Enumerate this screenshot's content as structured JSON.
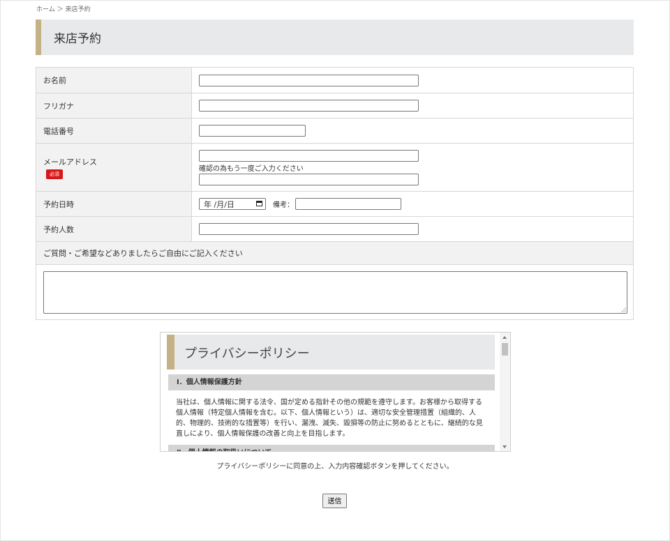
{
  "breadcrumb": "ホーム ＞ 来店予約",
  "title": "来店予約",
  "form": {
    "name_label": "お名前",
    "furigana_label": "フリガナ",
    "phone_label": "電話番号",
    "email_label": "メールアドレス",
    "required_badge": "必須",
    "email_confirm_note": "確認の為もう一度ご入力ください",
    "datetime_label": "予約日時",
    "date_placeholder": "年 /月/日",
    "remarks_label": "備考：",
    "party_size_label": "予約人数",
    "questions_label": "ご質問・ご希望などありましたらご自由にご記入ください"
  },
  "privacy": {
    "title": "プライバシーポリシー",
    "section1_title": "Ⅰ．個人情報保護方針",
    "section1_body": "当社は、個人情報に関する法令、国が定める指針その他の規範を遵守します。お客様から取得する個人情報（特定個人情報を含む。以下、個人情報という）は、適切な安全管理措置（組織的、人的、物理的、技術的な措置等）を行い、漏洩、滅失、毀損等の防止に努めるとともに、継続的な見直しにより、個人情報保護の改善と向上を目指します。",
    "section2_title": "Ⅱ．個人情報の取扱いについて"
  },
  "consent_text": "プライバシーポリシーに同意の上、入力内容確認ボタンを押してください。",
  "submit_label": "送信",
  "colors": {
    "accent": "#c4b185",
    "required": "#d81818",
    "label_bg": "#f2f2f2"
  }
}
